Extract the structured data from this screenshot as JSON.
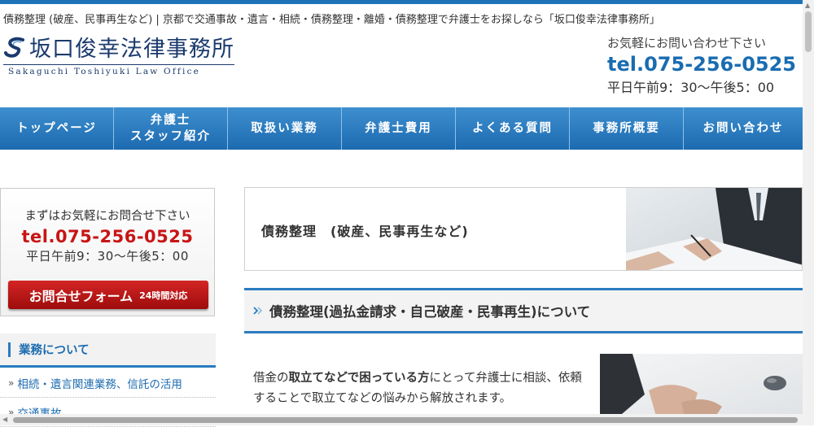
{
  "header": {
    "tagline": "債務整理 (破産、民事再生など) | 京都で交通事故・遺言・相続・債務整理・離婚・債務整理で弁護士をお探しなら「坂口俊幸法律事務所」",
    "logo_title": "坂口俊幸法律事務所",
    "logo_subtitle": "Sakaguchi Toshiyuki Law Office",
    "ask": "お気軽にお問い合わせ下さい",
    "tel": "tel.075-256-0525",
    "hours": "平日午前9：30〜午後5：00"
  },
  "nav": {
    "items": [
      {
        "label": "トップページ"
      },
      {
        "line1": "弁護士",
        "line2": "スタッフ紹介"
      },
      {
        "label": "取扱い業務"
      },
      {
        "label": "弁護士費用"
      },
      {
        "label": "よくある質問"
      },
      {
        "label": "事務所概要"
      },
      {
        "label": "お問い合わせ"
      }
    ]
  },
  "sidebar": {
    "contact": {
      "ask": "まずはお気軽にお問合せ下さい",
      "tel": "tel.075-256-0525",
      "hours": "平日午前9：30〜午後5：00",
      "button_main": "お問合せフォーム",
      "button_sub": "24時間対応"
    },
    "section_title": "業務について",
    "items": [
      {
        "bullet": "»",
        "label": "相続・遺言関連業務、信託の活用"
      },
      {
        "bullet": "»",
        "label": "交通事故"
      }
    ]
  },
  "main": {
    "page_title": "債務整理　(破産、民事再生など)",
    "section_title": "債務整理(過払金請求・自己破産・民事再生)について",
    "para_parts": [
      "借金の",
      "取立てなどで困っている方",
      "にとって弁護士に相談、依頼することで取立てなどの悩みから解放されます。"
    ]
  },
  "colors": {
    "brand_blue": "#1e73b8",
    "tel_red": "#c81414",
    "logo_navy": "#1a3a6e"
  }
}
